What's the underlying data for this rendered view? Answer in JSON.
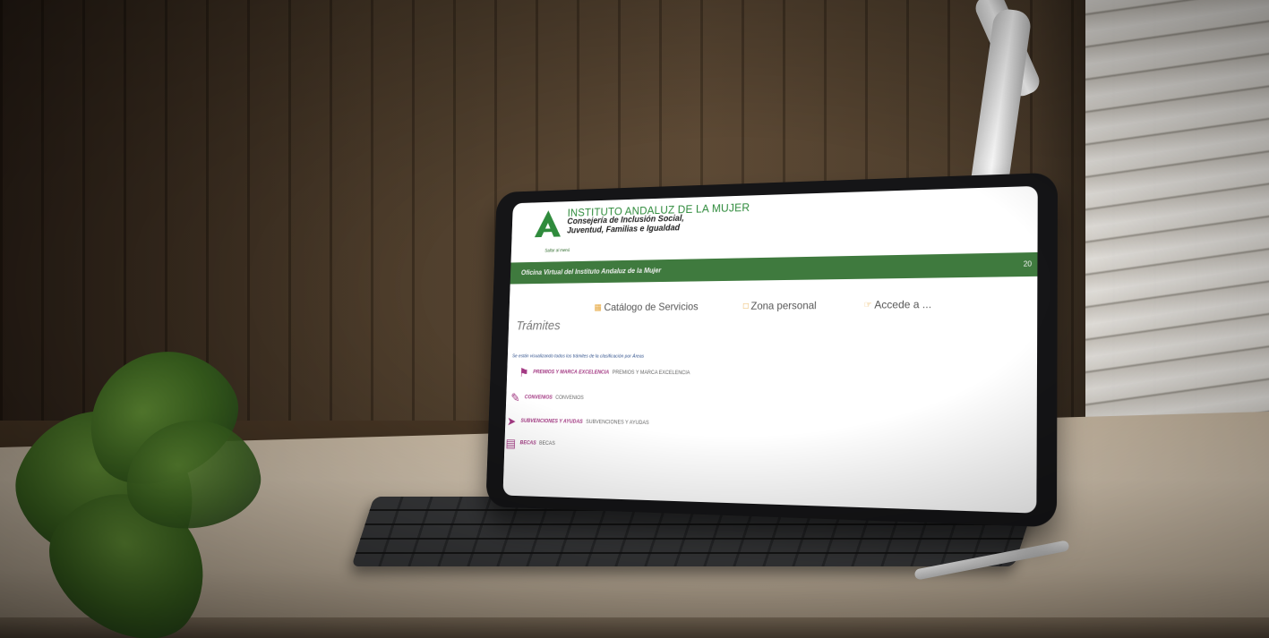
{
  "screen": {
    "brand": {
      "title": "INSTITUTO ANDALUZ DE LA MUJER",
      "subtitle_line1": "Consejería de Inclusión Social,",
      "subtitle_line2": "Juventud, Familias e Igualdad"
    },
    "skip_link": "Saltar al menú",
    "banner": {
      "text": "Oficina Virtual del Instituto Andaluz de la Mujer",
      "right_text": "20"
    },
    "nav": [
      {
        "label": "Catálogo de Servicios",
        "icon": "grid-icon"
      },
      {
        "label": "Zona personal",
        "icon": "folder-icon"
      },
      {
        "label": "Accede a ...",
        "icon": "pointer-icon"
      }
    ],
    "section_title": "Trámites",
    "intro": "Se están visualizando todos los trámites de la clasificación por Áreas",
    "rows": [
      {
        "strong": "PREMIOS Y MARCA EXCELENCIA",
        "plain": "PREMIOS Y MARCA EXCELENCIA",
        "icon": "bookmark-icon"
      },
      {
        "strong": "CONVENIOS",
        "plain": "CONVENIOS",
        "icon": "pencil-icon"
      },
      {
        "strong": "SUBVENCIONES Y AYUDAS",
        "plain": "SUBVENCIONES Y AYUDAS",
        "icon": "arrow-circle-icon"
      },
      {
        "strong": "BECAS",
        "plain": "BECAS",
        "icon": "book-icon"
      }
    ]
  },
  "colors": {
    "brand_green": "#3f7a3e",
    "accent_magenta": "#a33983",
    "icon_orange": "#e6a53a"
  }
}
